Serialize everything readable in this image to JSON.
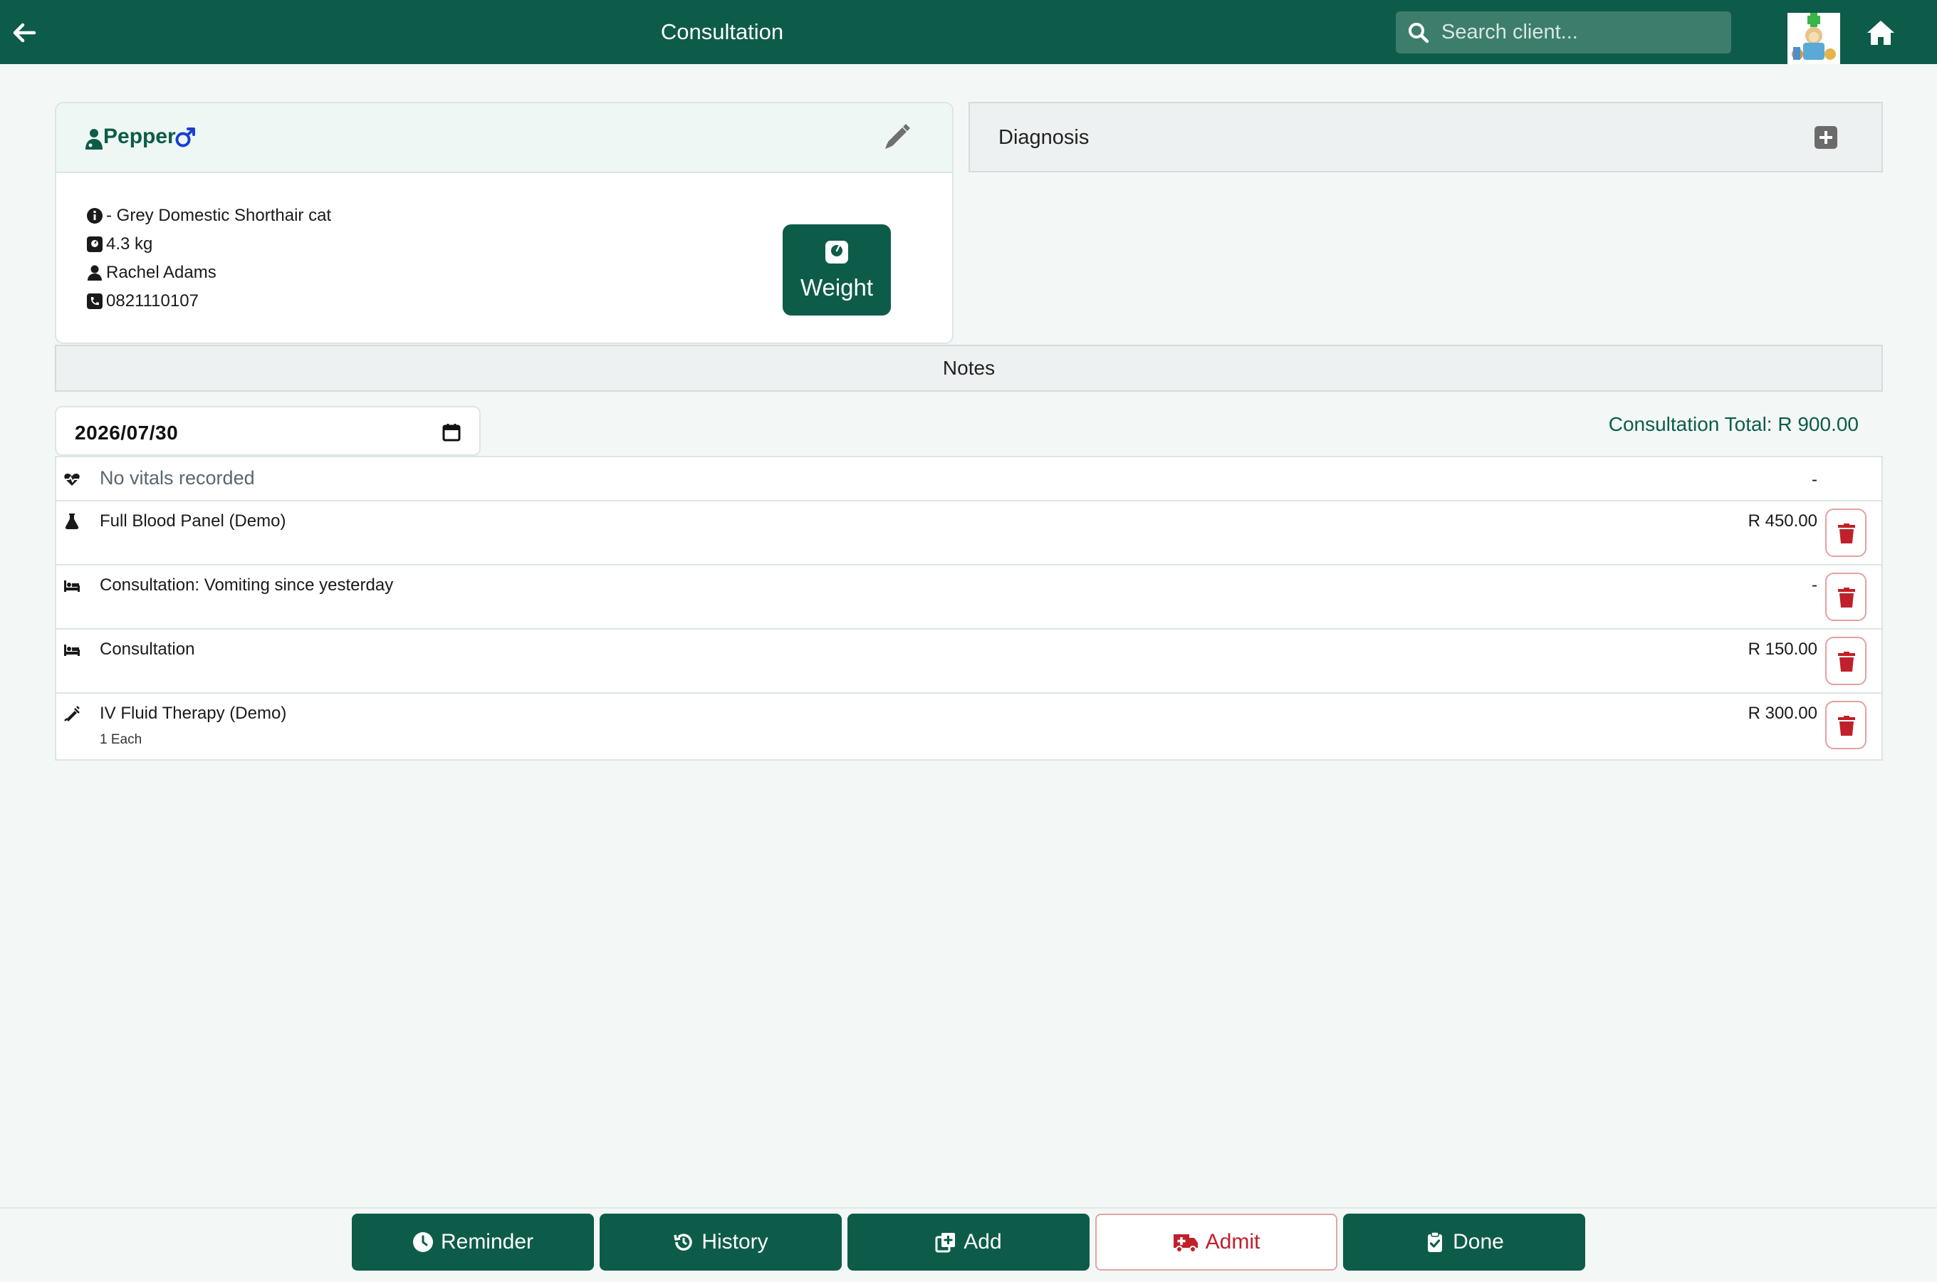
{
  "header": {
    "title": "Consultation",
    "search_placeholder": "Search client..."
  },
  "patient": {
    "name": "Pepper",
    "sex": "male",
    "description": "- Grey Domestic Shorthair cat",
    "weight": "4.3 kg",
    "owner": "Rachel Adams",
    "phone": "0821110107",
    "weight_button": "Weight"
  },
  "diagnosis": {
    "label": "Diagnosis"
  },
  "notes": {
    "label": "Notes"
  },
  "date": {
    "value": "2026/07/30"
  },
  "total": {
    "label": "Consultation Total: R 900.00"
  },
  "items": [
    {
      "icon": "heart-pulse-icon",
      "label": "No vitals recorded",
      "price": "-",
      "deletable": false
    },
    {
      "icon": "flask-icon",
      "label": "Full Blood Panel (Demo)",
      "price": "R 450.00",
      "deletable": true
    },
    {
      "icon": "bed-icon",
      "label": "Consultation: Vomiting since yesterday",
      "price": "-",
      "deletable": true
    },
    {
      "icon": "bed-icon",
      "label": "Consultation",
      "price": "R 150.00",
      "deletable": true
    },
    {
      "icon": "syringe-icon",
      "label": "IV Fluid Therapy (Demo)",
      "sub": "1 Each",
      "price": "R 300.00",
      "deletable": true
    }
  ],
  "bottom": {
    "reminder": "Reminder",
    "history": "History",
    "add": "Add",
    "admit": "Admit",
    "done": "Done"
  },
  "colors": {
    "primary": "#0d5c49",
    "danger": "#c0202a",
    "background": "#f3f8f7",
    "male": "#1a3fd6"
  }
}
